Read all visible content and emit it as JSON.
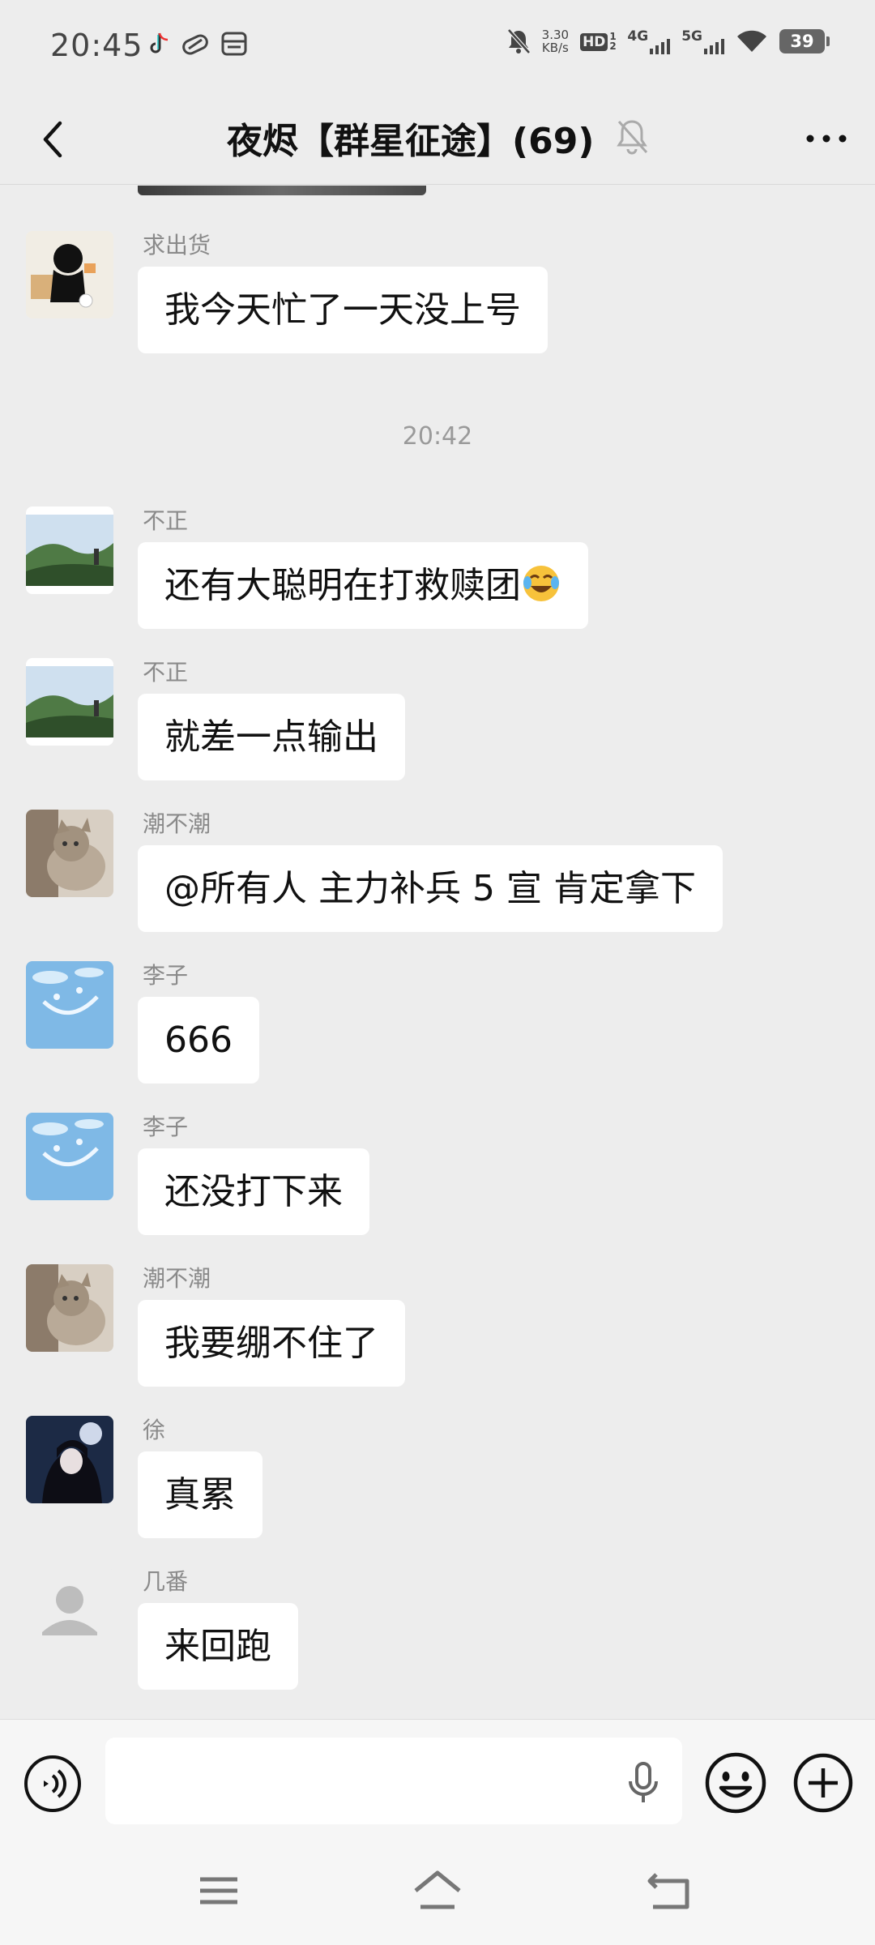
{
  "status_bar": {
    "time": "20:45",
    "speed_value": "3.30",
    "speed_unit": "KB/s",
    "hd": "HD",
    "hd_sub": "1 2",
    "net1": "4G",
    "net2": "5G",
    "battery": "39"
  },
  "nav": {
    "title": "夜烬【群星征途】(69)"
  },
  "chat": {
    "messages": [
      {
        "sender": "求出货",
        "text": "我今天忙了一天没上号"
      },
      {
        "timestamp": "20:42"
      },
      {
        "sender": "不正",
        "text": "还有大聪明在打救赎团"
      },
      {
        "sender": "不正",
        "text": "就差一点输出"
      },
      {
        "sender": "潮不潮",
        "text": "@所有人  主力补兵 5 宣 肯定拿下"
      },
      {
        "sender": "李子",
        "text": "666"
      },
      {
        "sender": "李子",
        "text": "还没打下来"
      },
      {
        "sender": "潮不潮",
        "text": "我要绷不住了"
      },
      {
        "sender": "徐",
        "text": "真累"
      },
      {
        "sender": "几番",
        "text": "来回跑"
      }
    ]
  },
  "input_bar": {
    "value": "",
    "placeholder": ""
  },
  "icons": {
    "back": "chevron-left-icon",
    "mute": "bell-off-icon",
    "more": "ellipsis-icon",
    "voice": "voice-icon",
    "mic": "mic-icon",
    "emoji": "smiley-icon",
    "plus": "plus-icon",
    "menu": "menu-icon",
    "home": "home-icon",
    "back_nav": "back-icon"
  },
  "colors": {
    "background": "#ededed",
    "bubble": "#ffffff",
    "sender": "#8a8a8a"
  }
}
